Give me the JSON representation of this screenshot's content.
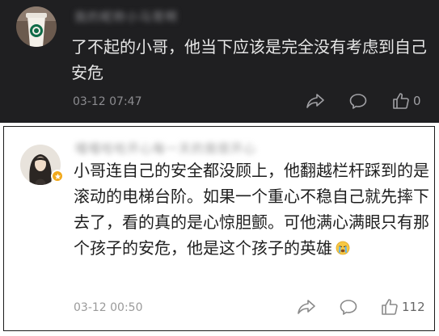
{
  "comments": [
    {
      "username": "我的昵称小马哥啊",
      "text": "了不起的小哥，他当下应该是完全没有考虑到自己安危",
      "timestamp": "03-12 07:47",
      "like_count": "0",
      "avatar_icon": "starbucks-cup-icon",
      "theme": "dark"
    },
    {
      "username": "嘻嘻哈哈开心每一天的我很开心",
      "text": "小哥连自己的安全都没顾上，他翻越栏杆踩到的是滚动的电梯台阶。如果一个重心不稳自己就先摔下去了，看的真的是心惊胆颤。可他满心满眼只有那个孩子的安危，他是这个孩子的英雄",
      "emoji": "crying-face-emoji",
      "timestamp": "03-12 00:50",
      "like_count": "112",
      "avatar_icon": "long-hair-portrait-icon",
      "badge_icon": "verified-badge-icon",
      "theme": "light"
    }
  ],
  "colors": {
    "dark_bg": "#1f1f21",
    "dark_text": "#e6e6e6",
    "light_text": "#1e1e1e",
    "meta_gray": "#9a9a9a",
    "badge_gold": "#f2a91b"
  }
}
